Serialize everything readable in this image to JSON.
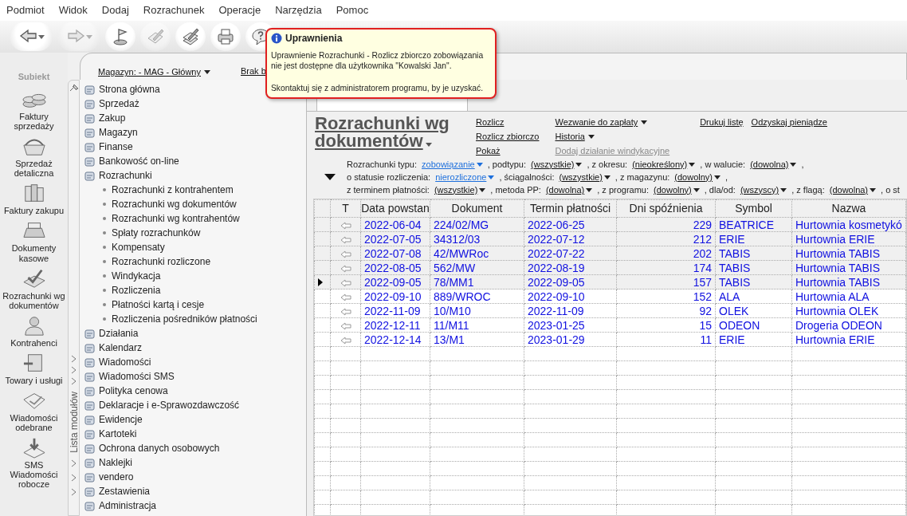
{
  "menu": [
    "Podmiot",
    "Widok",
    "Dodaj",
    "Rozrachunek",
    "Operacje",
    "Narzędzia",
    "Pomoc"
  ],
  "toolbar": [
    {
      "kind": "back",
      "disabled": false,
      "dropdown": true
    },
    {
      "kind": "forward",
      "disabled": true,
      "dropdown": true
    },
    {
      "kind": "flag",
      "disabled": false,
      "dropdown": false
    },
    {
      "kind": "sign",
      "disabled": true,
      "dropdown": false
    },
    {
      "kind": "sign-stack",
      "disabled": false,
      "dropdown": false
    },
    {
      "kind": "print",
      "disabled": false,
      "dropdown": false
    },
    {
      "kind": "help",
      "disabled": false,
      "dropdown": false
    }
  ],
  "rail": {
    "logo": "Subiekt",
    "items": [
      {
        "label": "Faktury sprzedaży"
      },
      {
        "label": "Sprzedaż detaliczna"
      },
      {
        "label": "Faktury zakupu"
      },
      {
        "label": "Dokumenty kasowe"
      },
      {
        "label": "Rozrachunki wg dokumentów"
      },
      {
        "label": "Kontrahenci"
      },
      {
        "label": "Towary i usługi"
      },
      {
        "label": "Wiadomości odebrane"
      },
      {
        "label": "SMS Wiadomości robocze"
      }
    ]
  },
  "header": {
    "warehouse": "Magazyn: - MAG - Główny",
    "other": "Brak b"
  },
  "modules": {
    "strip_label": "Lista modułów",
    "items": [
      {
        "label": "Strona główna"
      },
      {
        "label": "Sprzedaż"
      },
      {
        "label": "Zakup"
      },
      {
        "label": "Magazyn"
      },
      {
        "label": "Finanse"
      },
      {
        "label": "Bankowość on-line"
      },
      {
        "label": "Rozrachunki",
        "children": [
          {
            "label": "Rozrachunki z kontrahentem"
          },
          {
            "label": "Rozrachunki wg dokumentów"
          },
          {
            "label": "Rozrachunki wg kontrahentów"
          },
          {
            "label": "Spłaty rozrachunków"
          },
          {
            "label": "Kompensaty"
          },
          {
            "label": "Rozrachunki rozliczone"
          },
          {
            "label": "Windykacja"
          },
          {
            "label": "Rozliczenia"
          },
          {
            "label": "Płatności kartą i cesje"
          },
          {
            "label": "Rozliczenia pośredników płatności"
          }
        ]
      },
      {
        "label": "Działania"
      },
      {
        "label": "Kalendarz"
      },
      {
        "label": "Wiadomości"
      },
      {
        "label": "Wiadomości SMS"
      },
      {
        "label": "Polityka cenowa"
      },
      {
        "label": "Deklaracje i e-Sprawozdawczość"
      },
      {
        "label": "Ewidencje"
      },
      {
        "label": "Kartoteki"
      },
      {
        "label": "Ochrona danych osobowych"
      },
      {
        "label": "Naklejki"
      },
      {
        "label": "vendero"
      },
      {
        "label": "Zestawienia"
      },
      {
        "label": "Administracja"
      }
    ]
  },
  "view": {
    "title": "Rozrachunki wg dokumentów",
    "title_dropdown": true,
    "actions": [
      [
        {
          "label": "Rozlicz",
          "disabled": false,
          "dropdown": false
        },
        {
          "label": "Rozlicz zbiorczo",
          "disabled": false,
          "dropdown": false
        },
        {
          "label": "Pokaż",
          "disabled": false,
          "dropdown": false
        }
      ],
      [
        {
          "label": "Wezwanie do zapłaty",
          "disabled": false,
          "dropdown": true
        },
        {
          "label": "Historia",
          "disabled": false,
          "dropdown": true
        },
        {
          "label": "Dodaj działanie windykacyjne",
          "disabled": true,
          "dropdown": false
        }
      ],
      [
        {
          "label": "Drukuj listę",
          "disabled": false,
          "dropdown": false
        }
      ],
      [
        {
          "label": "Odzyskaj pieniądze",
          "disabled": false,
          "dropdown": false
        }
      ]
    ],
    "filters": [
      [
        {
          "kind": "label",
          "text": "Rozrachunki typu:"
        },
        {
          "kind": "dropdown",
          "text": "zobowiązanie",
          "changed": true
        },
        {
          "kind": "label",
          "text": ", podtypu:"
        },
        {
          "kind": "dropdown",
          "text": "(wszystkie)",
          "changed": false
        },
        {
          "kind": "label",
          "text": ", z okresu:"
        },
        {
          "kind": "dropdown",
          "text": "(nieokreślony)",
          "changed": false
        },
        {
          "kind": "label",
          "text": ", w walucie:"
        },
        {
          "kind": "dropdown",
          "text": "(dowolna)",
          "changed": false
        },
        {
          "kind": "label",
          "text": ","
        }
      ],
      [
        {
          "kind": "label",
          "text": "o statusie rozliczenia:"
        },
        {
          "kind": "dropdown",
          "text": "nierozliczone",
          "changed": true
        },
        {
          "kind": "label",
          "text": ", ściągalności:"
        },
        {
          "kind": "dropdown",
          "text": "(wszystkie)",
          "changed": false
        },
        {
          "kind": "label",
          "text": ", z magazynu:"
        },
        {
          "kind": "dropdown",
          "text": "(dowolny)",
          "changed": false
        },
        {
          "kind": "label",
          "text": ","
        }
      ],
      [
        {
          "kind": "label",
          "text": "z terminem płatności:"
        },
        {
          "kind": "dropdown",
          "text": "(wszystkie)",
          "changed": false
        },
        {
          "kind": "label",
          "text": ", metoda PP:"
        },
        {
          "kind": "dropdown",
          "text": "(dowolna)",
          "changed": false
        },
        {
          "kind": "label",
          "text": ", z programu:"
        },
        {
          "kind": "dropdown",
          "text": "(dowolny)",
          "changed": false
        },
        {
          "kind": "label",
          "text": ", dla/od:"
        },
        {
          "kind": "dropdown",
          "text": "(wszyscy)",
          "changed": false
        },
        {
          "kind": "label",
          "text": ", z flagą:"
        },
        {
          "kind": "dropdown",
          "text": "(dowolna)",
          "changed": false
        },
        {
          "kind": "label",
          "text": ", o st"
        }
      ]
    ],
    "table": {
      "columns": [
        "",
        "T",
        "Data powstan",
        "Dokument",
        "Termin płatności",
        "Dni spóźnienia",
        "Symbol",
        "Nazwa"
      ],
      "rows": [
        {
          "selected": false,
          "shaded": true,
          "cells": [
            "",
            "",
            "2022-06-04",
            "224/02/MG",
            "2022-06-25",
            "229",
            "BEATRICE",
            "Hurtownia kosmetykó"
          ]
        },
        {
          "selected": false,
          "shaded": true,
          "cells": [
            "",
            "",
            "2022-07-05",
            "34312/03",
            "2022-07-12",
            "212",
            "ERIE",
            "Hurtownia ERIE"
          ]
        },
        {
          "selected": false,
          "shaded": true,
          "cells": [
            "",
            "",
            "2022-07-08",
            "42/MWRoc",
            "2022-07-22",
            "202",
            "TABIS",
            "Hurtownia TABIS"
          ]
        },
        {
          "selected": false,
          "shaded": true,
          "cells": [
            "",
            "",
            "2022-08-05",
            "562/MW",
            "2022-08-19",
            "174",
            "TABIS",
            "Hurtownia TABIS"
          ]
        },
        {
          "selected": true,
          "shaded": true,
          "cells": [
            "",
            "",
            "2022-09-05",
            "78/MM1",
            "2022-09-05",
            "157",
            "TABIS",
            "Hurtownia TABIS"
          ]
        },
        {
          "selected": false,
          "shaded": false,
          "cells": [
            "",
            "",
            "2022-09-10",
            "889/WROC",
            "2022-09-10",
            "152",
            "ALA",
            "Hurtownia ALA"
          ]
        },
        {
          "selected": false,
          "shaded": false,
          "cells": [
            "",
            "",
            "2022-11-09",
            "10/M10",
            "2022-11-09",
            "92",
            "OLEK",
            "Hurtownia OLEK"
          ]
        },
        {
          "selected": false,
          "shaded": false,
          "cells": [
            "",
            "",
            "2022-12-11",
            "11/M11",
            "2023-01-25",
            "15",
            "ODEON",
            "Drogeria ODEON"
          ]
        },
        {
          "selected": false,
          "shaded": false,
          "cells": [
            "",
            "",
            "2022-12-14",
            "13/M1",
            "2023-01-29",
            "11",
            "ERIE",
            "Hurtownia ERIE"
          ]
        }
      ]
    }
  },
  "tooltip": {
    "title": "Uprawnienia",
    "message": "Uprawnienie Rozrachunki - Rozlicz zbiorczo zobowiązania nie jest dostępne dla użytkownika \"Kowalski Jan\".",
    "hint": "Skontaktuj się z administratorem programu, by je uzyskać."
  }
}
